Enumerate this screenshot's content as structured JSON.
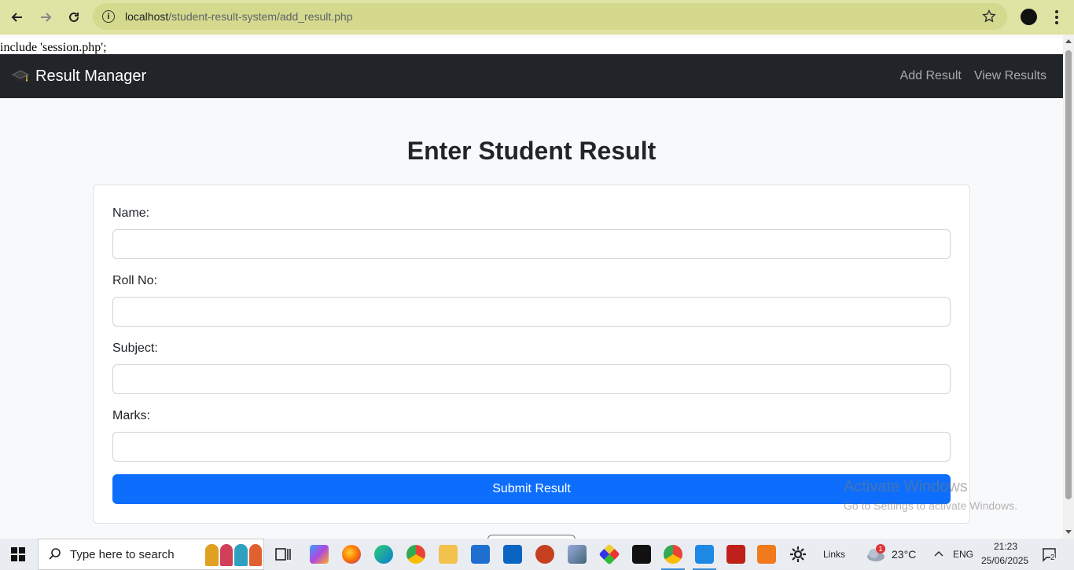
{
  "browser": {
    "url_host": "localhost",
    "url_path": "/student-result-system/add_result.php"
  },
  "page": {
    "php_leak": "include 'session.php';",
    "navbar": {
      "brand": "Result Manager",
      "links": [
        "Add Result",
        "View Results"
      ]
    },
    "heading": "Enter Student Result",
    "form": {
      "fields": [
        {
          "label": "Name:",
          "value": ""
        },
        {
          "label": "Roll No:",
          "value": ""
        },
        {
          "label": "Subject:",
          "value": ""
        },
        {
          "label": "Marks:",
          "value": ""
        }
      ],
      "submit_label": "Submit Result"
    },
    "watermark": {
      "line1": "Activate Windows",
      "line2": "Go to Settings to activate Windows."
    }
  },
  "taskbar": {
    "search_placeholder": "Type here to search",
    "links_label": "Links",
    "weather_badge": "1",
    "temperature": "23°C",
    "language": "ENG",
    "time": "21:23",
    "date": "25/06/2025",
    "notification_count": "2"
  },
  "colors": {
    "chrome_bg": "#dfe3a3",
    "navbar_bg": "#212529",
    "primary": "#0d6efd"
  }
}
